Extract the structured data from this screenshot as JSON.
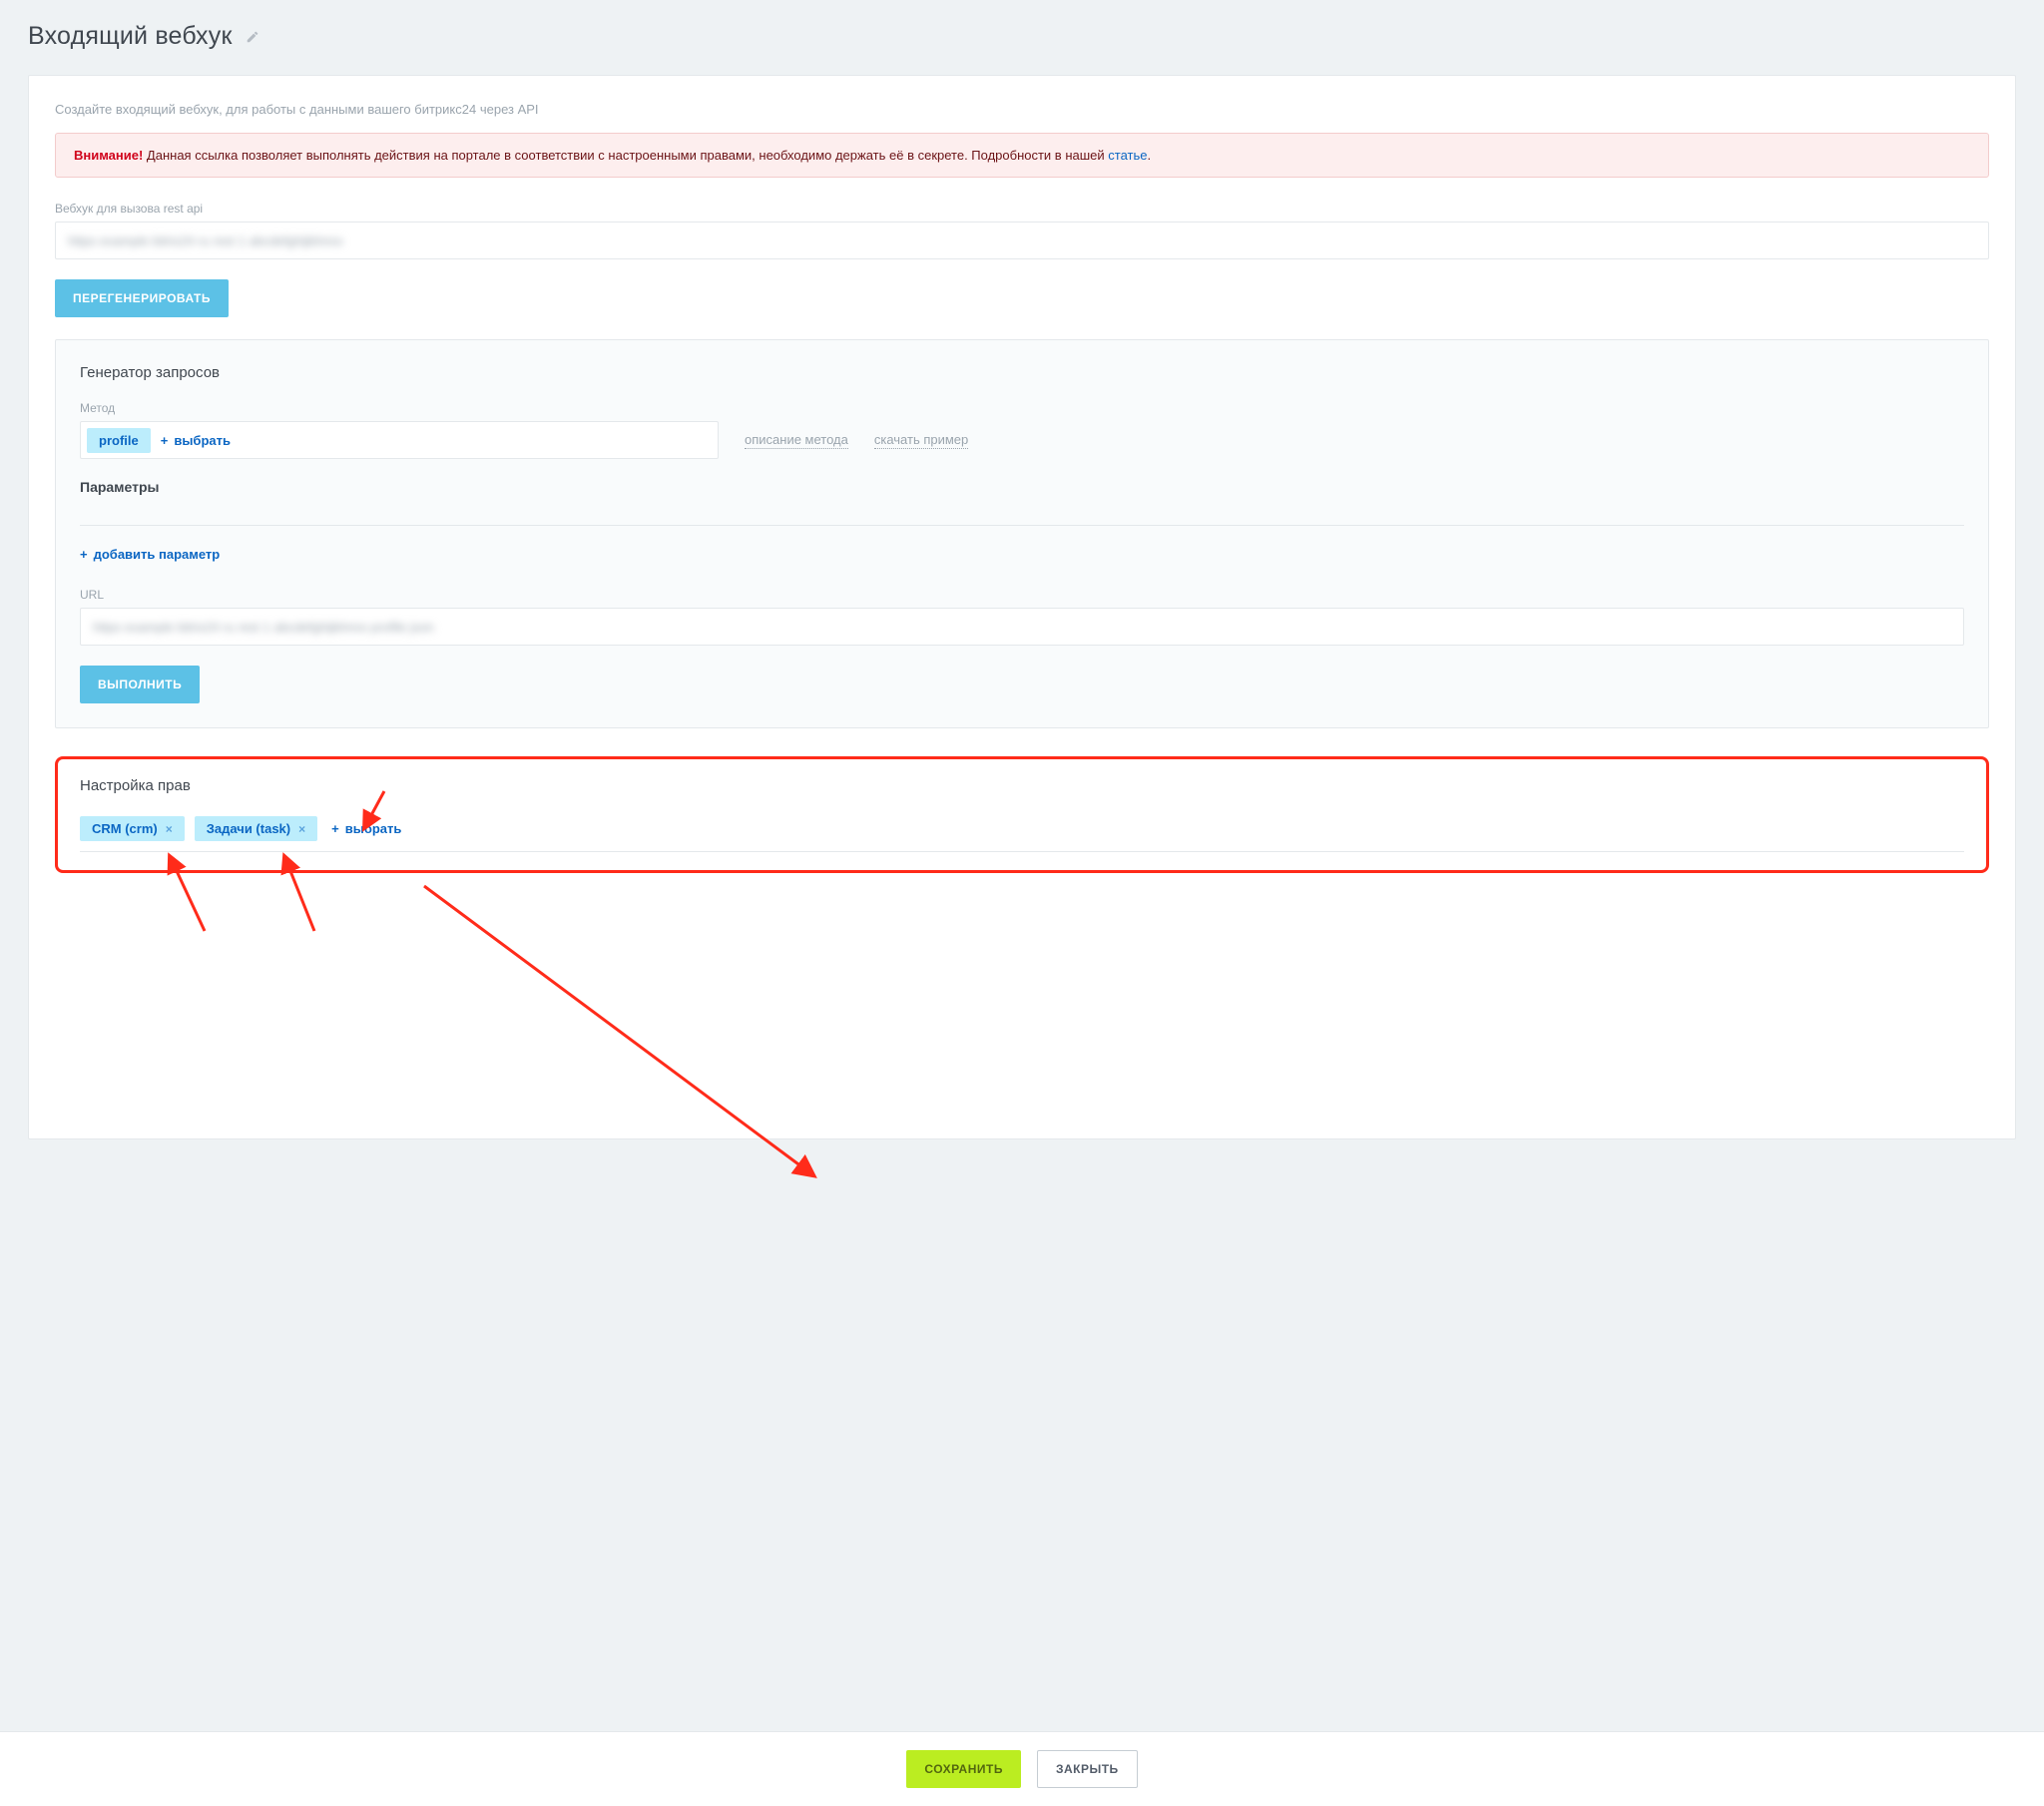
{
  "page": {
    "title": "Входящий вебхук",
    "intro": "Создайте входящий вебхук, для работы с данными вашего битрикс24 через API"
  },
  "alert": {
    "strong": "Внимание!",
    "text": " Данная ссылка позволяет выполнять действия на портале в соответствии с настроенными правами, необходимо держать её в секрете. Подробности в нашей ",
    "link_text": "статье",
    "tail": "."
  },
  "webhook": {
    "label": "Вебхук для вызова rest api",
    "masked": "https example bitrix24 ru rest 1 abcdefghijklmno"
  },
  "buttons": {
    "regenerate": "ПЕРЕГЕНЕРИРОВАТЬ",
    "execute": "ВЫПОЛНИТЬ",
    "save": "СОХРАНИТЬ",
    "close": "ЗАКРЫТЬ"
  },
  "generator": {
    "heading": "Генератор запросов",
    "method_label": "Метод",
    "method_chip": "profile",
    "select_label": "выбрать",
    "link_desc": "описание метода",
    "link_download": "скачать пример",
    "params_title": "Параметры",
    "add_param": "добавить параметр",
    "url_label": "URL",
    "url_masked": "https example bitrix24 ru rest 1 abcdefghijklmno profile json"
  },
  "rights": {
    "heading": "Настройка прав",
    "chips": [
      "CRM (crm)",
      "Задачи (task)"
    ],
    "select_label": "выбрать"
  },
  "colors": {
    "blue": "#5cc1e6",
    "green": "#bbed21",
    "red": "#ff2b1a",
    "link": "#0b66c3"
  }
}
